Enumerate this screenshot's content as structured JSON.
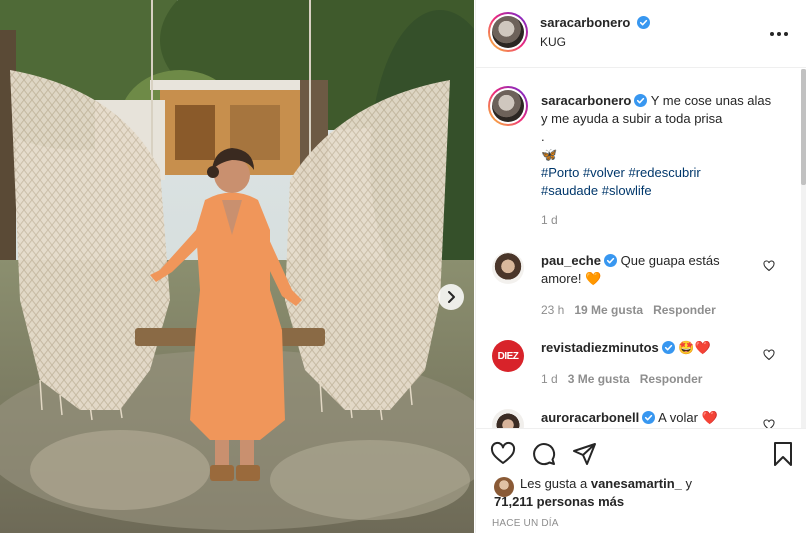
{
  "post": {
    "username": "saracarbonero",
    "location": "KUG",
    "verified": true
  },
  "caption": {
    "username": "saracarbonero",
    "text": "Y me cose unas alas y me ayuda a subir a toda prisa",
    "dot": ".",
    "emoji": "🦋",
    "hashtags_line1": [
      "#Porto",
      "#volver",
      "#redescubrir"
    ],
    "hashtags_line2": [
      "#saudade",
      "#slowlife"
    ],
    "age": "1 d"
  },
  "comments": [
    {
      "username": "pau_eche",
      "verified": true,
      "text": "Que guapa estás amore!",
      "emoji": "🧡",
      "age": "23 h",
      "likes": "19 Me gusta",
      "reply": "Responder"
    },
    {
      "username": "revistadiezminutos",
      "verified": true,
      "text": "",
      "emoji": "🤩❤️",
      "age": "1 d",
      "likes": "3 Me gusta",
      "reply": "Responder",
      "avatar_text": "DIEZ"
    },
    {
      "username": "auroracarbonell",
      "verified": true,
      "text": "A volar",
      "emoji": "❤️"
    }
  ],
  "likes": {
    "prefix": "Les gusta a",
    "first_user": "vanesamartin_",
    "connector": "y",
    "others": "71,211 personas más"
  },
  "timestamp": "HACE UN DÍA",
  "icons": {
    "more": "more-dots-icon",
    "like": "heart-icon",
    "comment": "comment-icon",
    "share": "share-icon",
    "save": "bookmark-icon",
    "next": "chevron-right-icon"
  },
  "colors": {
    "verified": "#3897f0",
    "hashtag": "#00376b",
    "muted": "#8e8e8e",
    "text": "#262626"
  }
}
